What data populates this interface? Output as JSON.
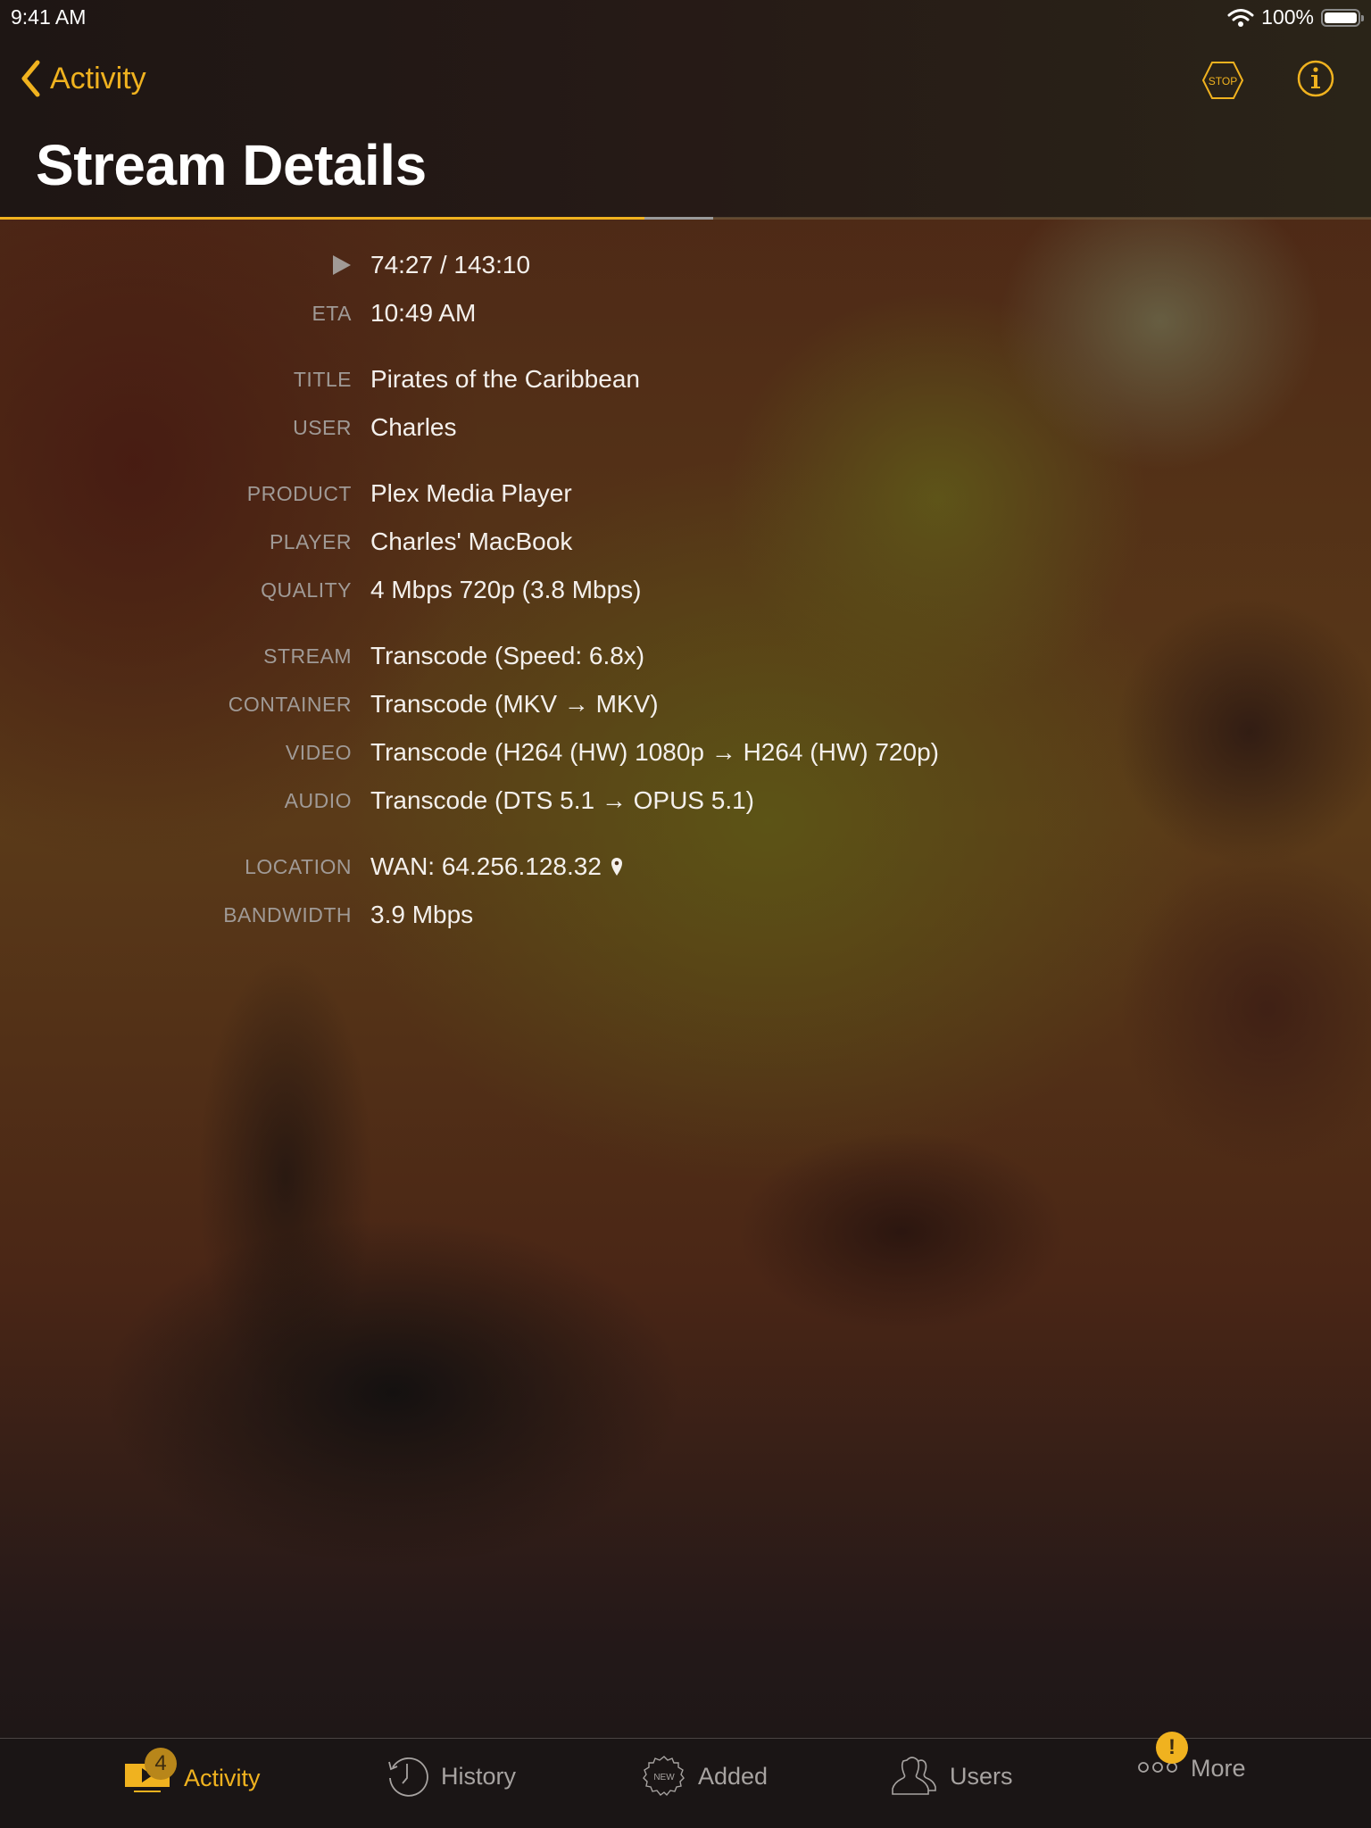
{
  "status_bar": {
    "time": "9:41 AM",
    "battery_percent": "100%",
    "wifi_icon": "wifi-icon",
    "battery_icon": "battery-full-icon"
  },
  "nav": {
    "back_label": "Activity",
    "back_icon": "chevron-left-icon",
    "stop_label": "STOP",
    "stop_icon": "stop-sign-icon",
    "info_icon": "info-icon",
    "title": "Stream Details"
  },
  "progress": {
    "watched_fraction": 0.47,
    "buffered_fraction": 0.52,
    "accent_color": "#f0b21f",
    "buffer_color": "#9a9a9a"
  },
  "details": {
    "groups": [
      [
        {
          "label": "",
          "icon": "play-icon",
          "value": "74:27 / 143:10"
        },
        {
          "label": "ETA",
          "value": "10:49 AM"
        }
      ],
      [
        {
          "label": "TITLE",
          "value": "Pirates of the Caribbean"
        },
        {
          "label": "USER",
          "value": "Charles"
        }
      ],
      [
        {
          "label": "PRODUCT",
          "value": "Plex Media Player"
        },
        {
          "label": "PLAYER",
          "value": "Charles' MacBook"
        },
        {
          "label": "QUALITY",
          "value": "4 Mbps 720p (3.8 Mbps)"
        }
      ],
      [
        {
          "label": "STREAM",
          "value": "Transcode (Speed: 6.8x)"
        },
        {
          "label": "CONTAINER",
          "value": "Transcode (MKV → MKV)"
        },
        {
          "label": "VIDEO",
          "value": "Transcode (H264 (HW) 1080p → H264 (HW) 720p)"
        },
        {
          "label": "AUDIO",
          "value": "Transcode (DTS 5.1 → OPUS 5.1)"
        }
      ],
      [
        {
          "label": "LOCATION",
          "value": "WAN: 64.256.128.32",
          "icon": "map-pin-icon"
        },
        {
          "label": "BANDWIDTH",
          "value": "3.9 Mbps"
        }
      ]
    ]
  },
  "tab_bar": {
    "tabs": [
      {
        "label": "Activity",
        "icon": "play-screen-icon",
        "active": true,
        "badge": "4"
      },
      {
        "label": "History",
        "icon": "clock-history-icon",
        "active": false
      },
      {
        "label": "Added",
        "icon": "new-badge-icon",
        "active": false,
        "icon_text": "NEW"
      },
      {
        "label": "Users",
        "icon": "users-icon",
        "active": false
      },
      {
        "label": "More",
        "icon": "more-dots-icon",
        "active": false,
        "badge": "!"
      }
    ]
  }
}
